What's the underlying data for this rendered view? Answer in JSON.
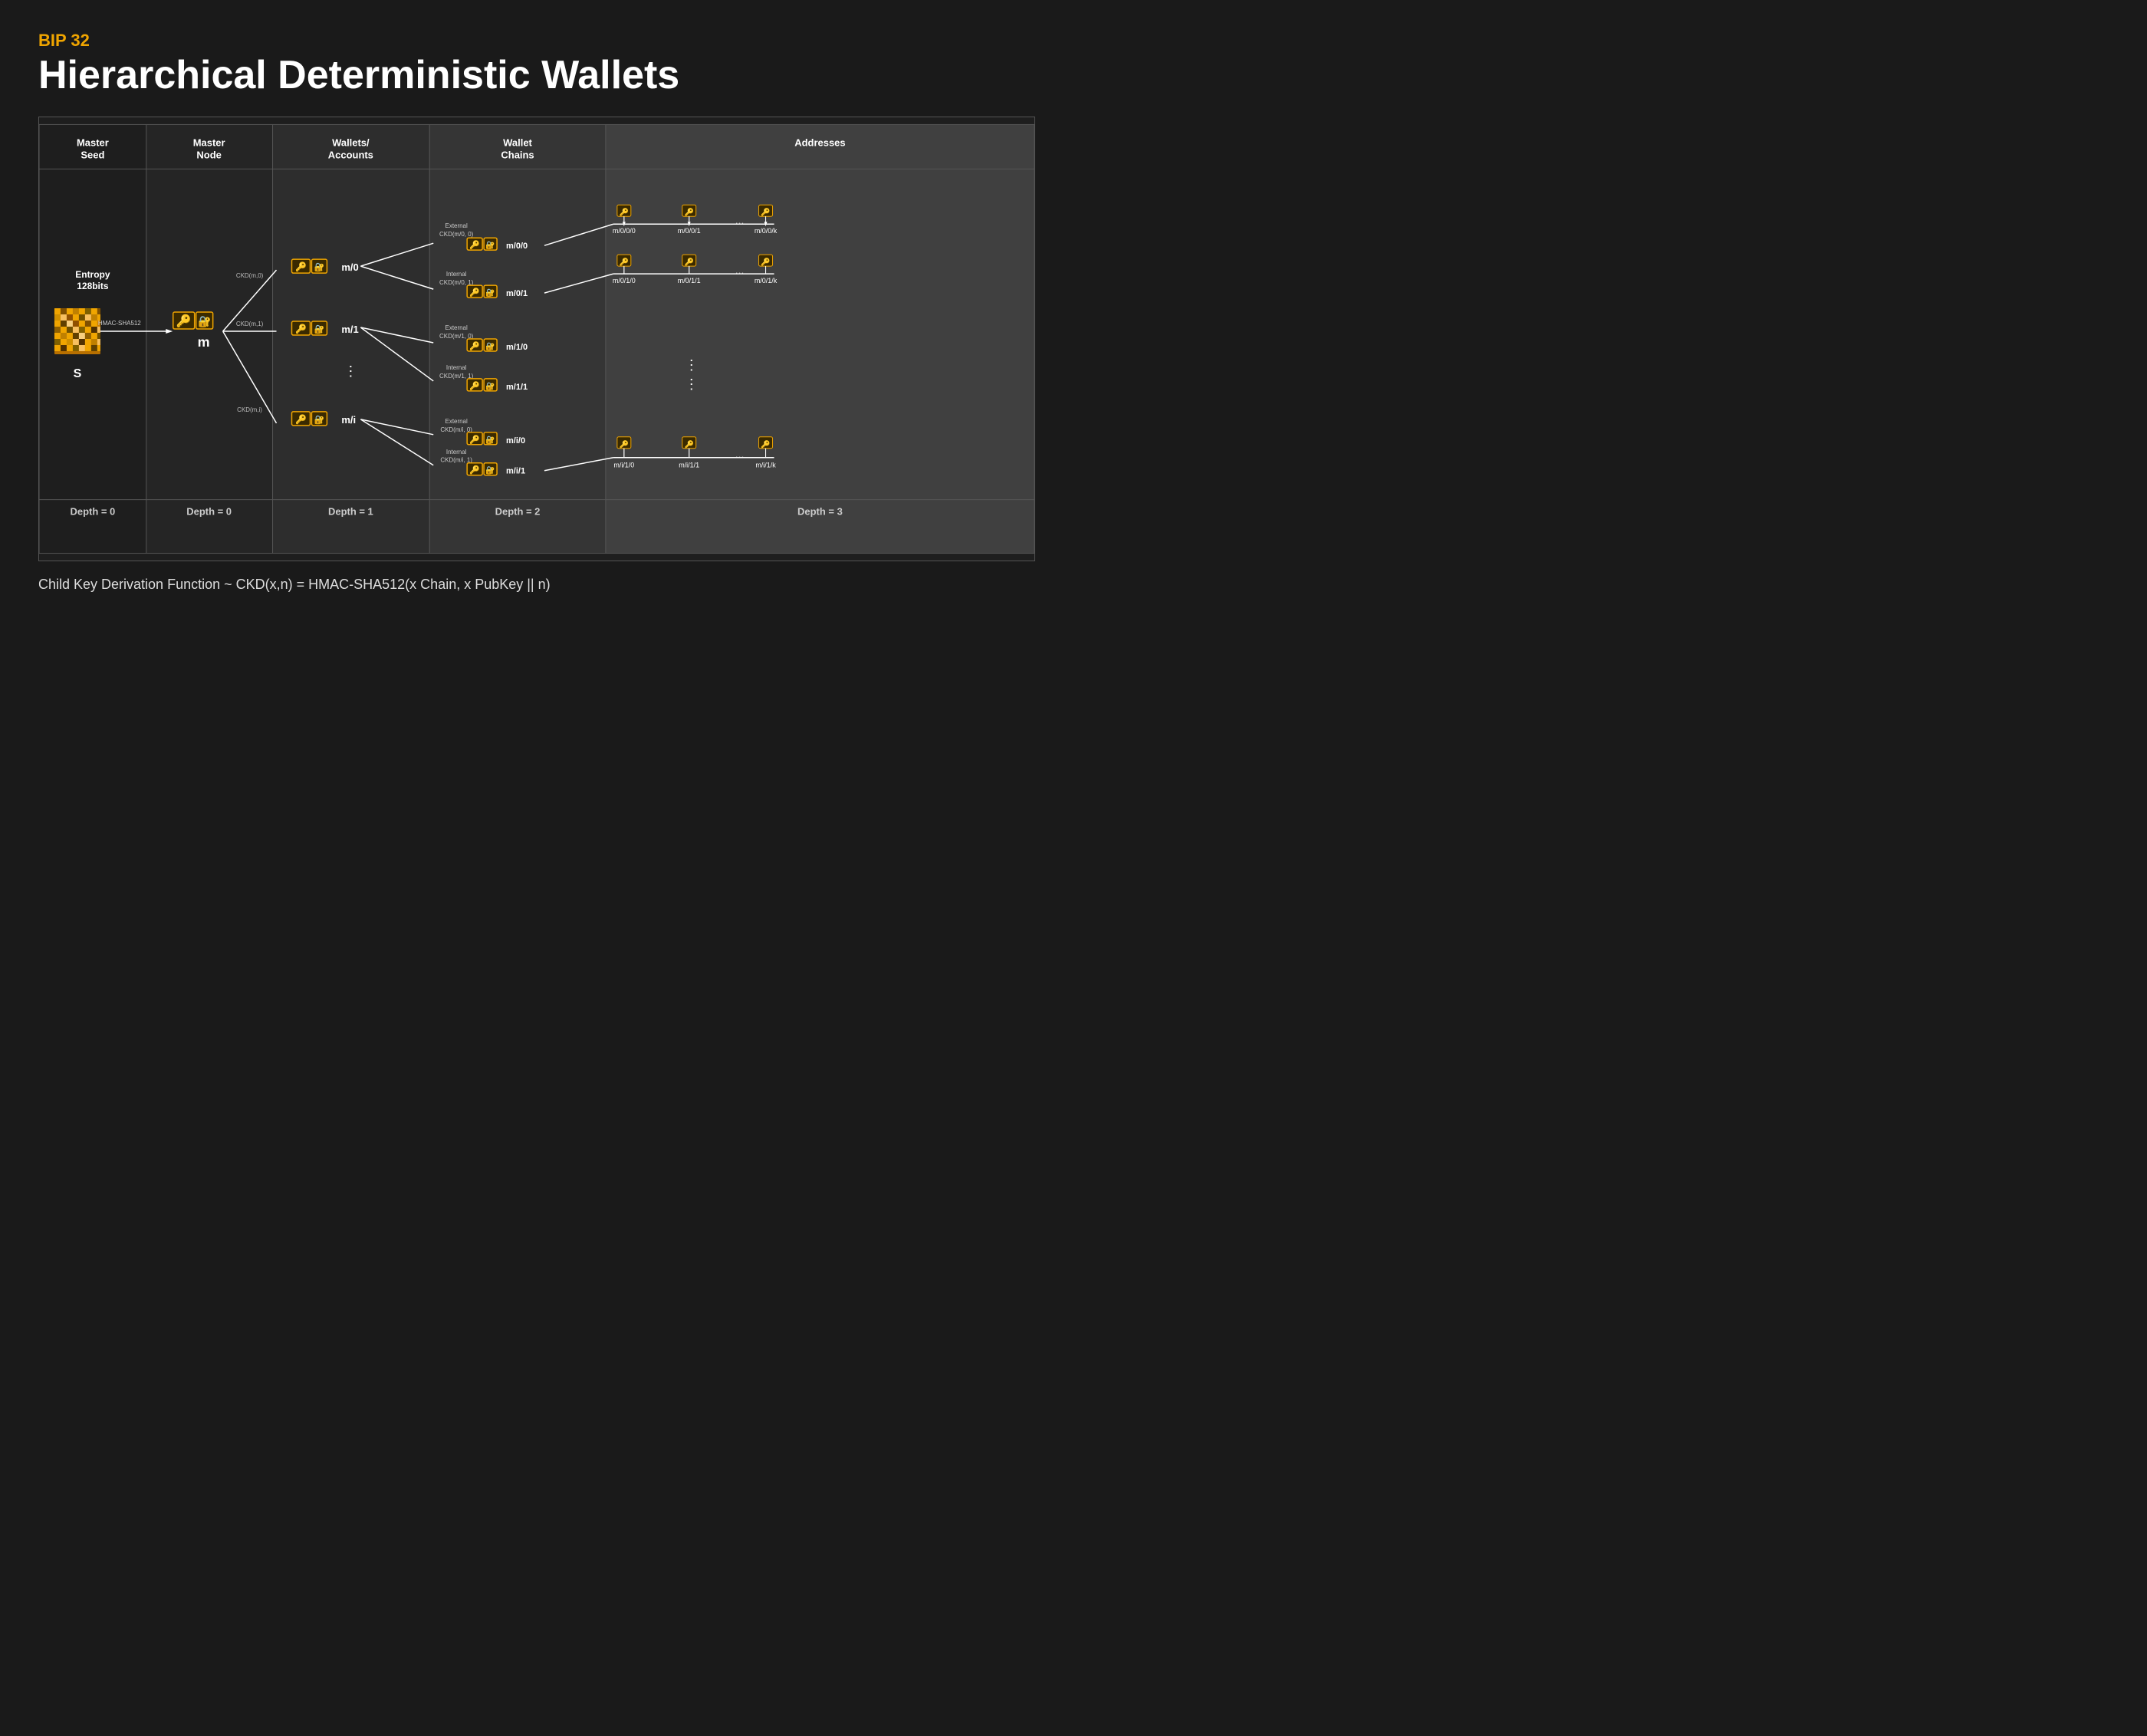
{
  "header": {
    "bip_label": "BIP 32",
    "title": "Hierarchical Deterministic Wallets"
  },
  "columns": {
    "master_seed": {
      "header": "Master\nSeed",
      "depth": "Depth = 0",
      "entropy_label": "Entropy\n128bits",
      "seed_label": "S",
      "hmac_label": "HMAC-SHA512"
    },
    "master_node": {
      "header": "Master\nNode",
      "depth": "Depth = 0",
      "label": "m"
    },
    "wallets": {
      "header": "Wallets/\nAccounts",
      "depth": "Depth = 1",
      "items": [
        {
          "ckd": "CKD(m,0)",
          "label": "m/0"
        },
        {
          "ckd": "CKD(m,1)",
          "label": "m/1"
        },
        {
          "ckd": "CKD(m,i)",
          "label": "m/i"
        }
      ]
    },
    "wallet_chains": {
      "header": "Wallet\nChains",
      "depth": "Depth = 2",
      "items": [
        {
          "ckd": "External\nCKD(m/0, 0)",
          "label": "m/0/0"
        },
        {
          "ckd": "Internal\nCKD(m/0, 1)",
          "label": "m/0/1"
        },
        {
          "ckd": "External\nCKD(m/1, 0)",
          "label": "m/1/0"
        },
        {
          "ckd": "Internal\nCKD(m/1, 1)",
          "label": "m/1/1"
        },
        {
          "ckd": "External\nCKD(m/i, 0)",
          "label": "m/i/0"
        },
        {
          "ckd": "Internal\nCKD(m/i, 1)",
          "label": "m/i/1"
        }
      ]
    },
    "addresses": {
      "header": "Addresses",
      "depth": "Depth = 3",
      "rows": [
        {
          "items": [
            "m/0/0/0",
            "m/0/0/1",
            "...",
            "m/0/0/k"
          ],
          "source": "m/0/0"
        },
        {
          "items": [
            "m/0/1/0",
            "m/0/1/1",
            "...",
            "m/0/1/k"
          ],
          "source": "m/0/1"
        },
        {
          "items": [
            "m/i/1/0",
            "m/i/1/1",
            "...",
            "m/i/1/k"
          ],
          "source": "m/i/1"
        }
      ]
    }
  },
  "footer": {
    "note": "Child Key Derivation Function ~ CKD(x,n) = HMAC-SHA512(x Chain, x PubKey || n)"
  },
  "colors": {
    "bg": "#1a1a1a",
    "accent": "#f0a500",
    "col1_bg": "#222222",
    "col2_bg": "#2a2a2a",
    "col3_bg": "#303030",
    "col4_bg": "#383838",
    "col5_bg": "#444444",
    "border": "#555555"
  }
}
